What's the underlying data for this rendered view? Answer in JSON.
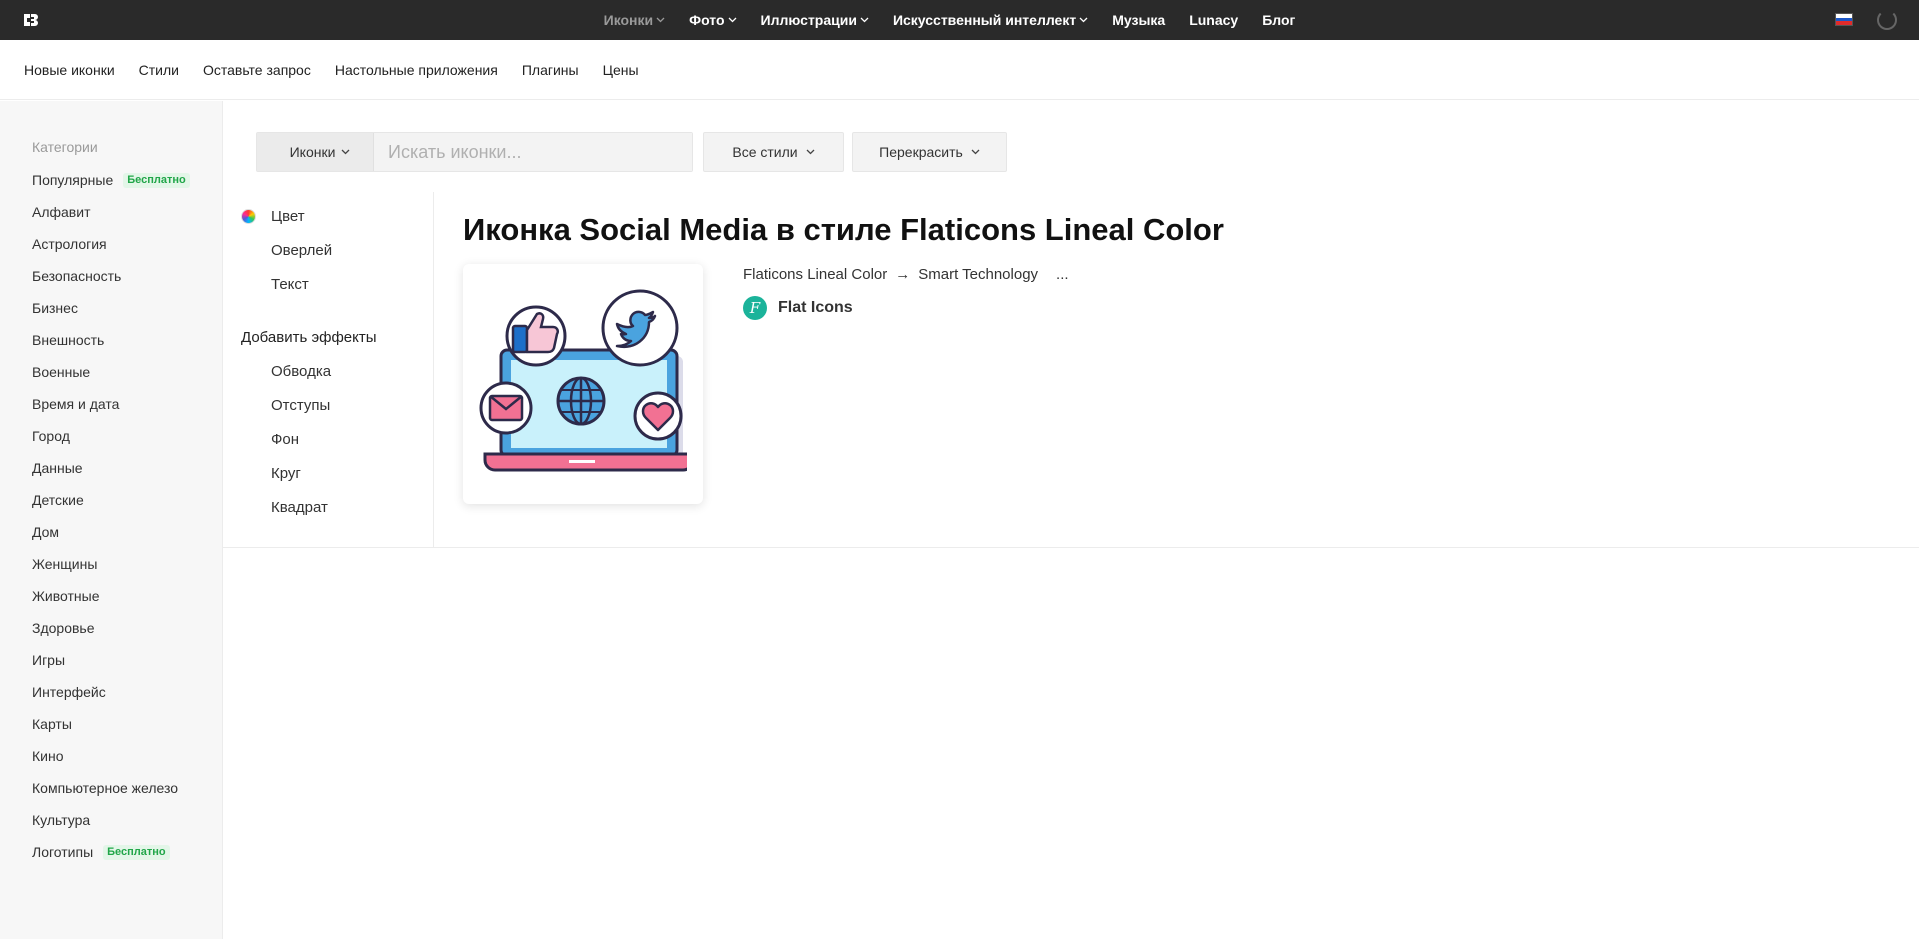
{
  "topnav": {
    "items": [
      {
        "label": "Иконки",
        "dropdown": true
      },
      {
        "label": "Фото",
        "dropdown": true
      },
      {
        "label": "Иллюстрации",
        "dropdown": true
      },
      {
        "label": "Искусственный интеллект",
        "dropdown": true
      },
      {
        "label": "Музыка",
        "dropdown": false
      },
      {
        "label": "Lunacy",
        "dropdown": false
      },
      {
        "label": "Блог",
        "dropdown": false
      }
    ],
    "language_flag": "ru-flag-icon",
    "loading_indicator": "spinner-icon"
  },
  "subnav": {
    "items": [
      "Новые иконки",
      "Стили",
      "Оставьте запрос",
      "Настольные приложения",
      "Плагины",
      "Цены"
    ]
  },
  "sidebar": {
    "heading": "Категории",
    "items": [
      {
        "label": "Популярные",
        "badge": "Бесплатно"
      },
      {
        "label": "Алфавит"
      },
      {
        "label": "Астрология"
      },
      {
        "label": "Безопасность"
      },
      {
        "label": "Бизнес"
      },
      {
        "label": "Внешность"
      },
      {
        "label": "Военные"
      },
      {
        "label": "Время и дата"
      },
      {
        "label": "Город"
      },
      {
        "label": "Данные"
      },
      {
        "label": "Детские"
      },
      {
        "label": "Дом"
      },
      {
        "label": "Женщины"
      },
      {
        "label": "Животные"
      },
      {
        "label": "Здоровье"
      },
      {
        "label": "Игры"
      },
      {
        "label": "Интерфейс"
      },
      {
        "label": "Карты"
      },
      {
        "label": "Кино"
      },
      {
        "label": "Компьютерное железо"
      },
      {
        "label": "Культура"
      },
      {
        "label": "Логотипы",
        "badge": "Бесплатно"
      }
    ]
  },
  "search": {
    "type_label": "Иконки",
    "placeholder": "Искать иконки...",
    "styles_label": "Все стили",
    "recolor_label": "Перекрасить"
  },
  "options": {
    "color": "Цвет",
    "overlay": "Оверлей",
    "text": "Текст",
    "effects_heading": "Добавить эффекты",
    "stroke": "Обводка",
    "padding": "Отступы",
    "background": "Фон",
    "circle": "Круг",
    "square": "Квадрат"
  },
  "main": {
    "title": "Иконка Social Media в стиле Flaticons Lineal Color",
    "style_link": "Flaticons Lineal Color",
    "arrow": "→",
    "pack_link": "Smart Technology",
    "more": "...",
    "author_initial": "F",
    "author_name": "Flat Icons"
  },
  "colors": {
    "topbar": "#2a2a2a",
    "badge_green": "#21a649",
    "author_teal": "#1bb39a"
  }
}
